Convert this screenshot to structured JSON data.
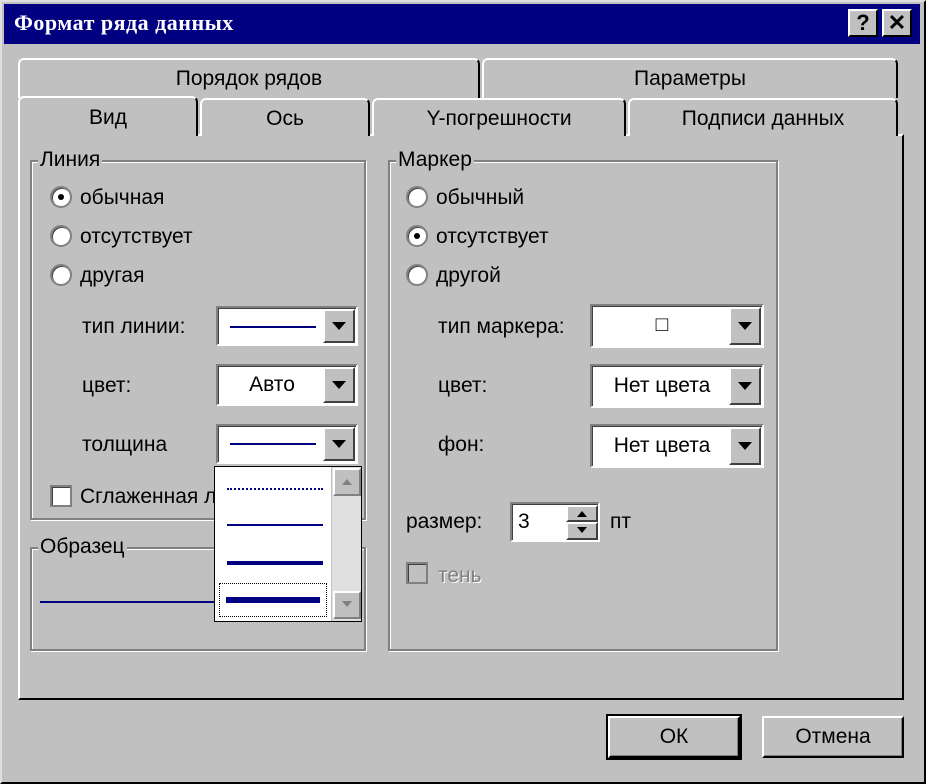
{
  "window": {
    "title": "Формат ряда данных",
    "help_button": "?",
    "close_button": "✕"
  },
  "tabs": {
    "row1": [
      {
        "label": "Порядок рядов"
      },
      {
        "label": "Параметры"
      }
    ],
    "row2": [
      {
        "label": "Вид",
        "selected": true
      },
      {
        "label": "Ось"
      },
      {
        "label": "Y-погрешности"
      },
      {
        "label": "Подписи данных"
      }
    ]
  },
  "line_group": {
    "title": "Линия",
    "options": [
      {
        "label": "обычная",
        "selected": true
      },
      {
        "label": "отсутствует",
        "selected": false
      },
      {
        "label": "другая",
        "selected": false
      }
    ],
    "line_type_label": "тип линии:",
    "color_label": "цвет:",
    "color_value": "Авто",
    "thickness_label": "толщина",
    "smoothed_label": "Сглаженная л",
    "smoothed_checked": false,
    "line_color": "#000080"
  },
  "thickness_dropdown": {
    "items": [
      {
        "style": "dotted-thin"
      },
      {
        "style": "thin"
      },
      {
        "style": "medium"
      },
      {
        "style": "thick",
        "selected": true
      }
    ]
  },
  "sample_group": {
    "title": "Образец"
  },
  "marker_group": {
    "title": "Маркер",
    "options": [
      {
        "label": "обычный",
        "selected": false
      },
      {
        "label": "отсутствует",
        "selected": true
      },
      {
        "label": "другой",
        "selected": false
      }
    ],
    "marker_type_label": "тип маркера:",
    "marker_type_value": "□",
    "color_label": "цвет:",
    "color_value": "Нет цвета",
    "background_label": "фон:",
    "background_value": "Нет цвета",
    "size_label": "размер:",
    "size_value": "3",
    "size_unit": "пт",
    "shadow_label": "тень",
    "shadow_enabled": false
  },
  "footer": {
    "ok_label": "ОК",
    "cancel_label": "Отмена"
  }
}
